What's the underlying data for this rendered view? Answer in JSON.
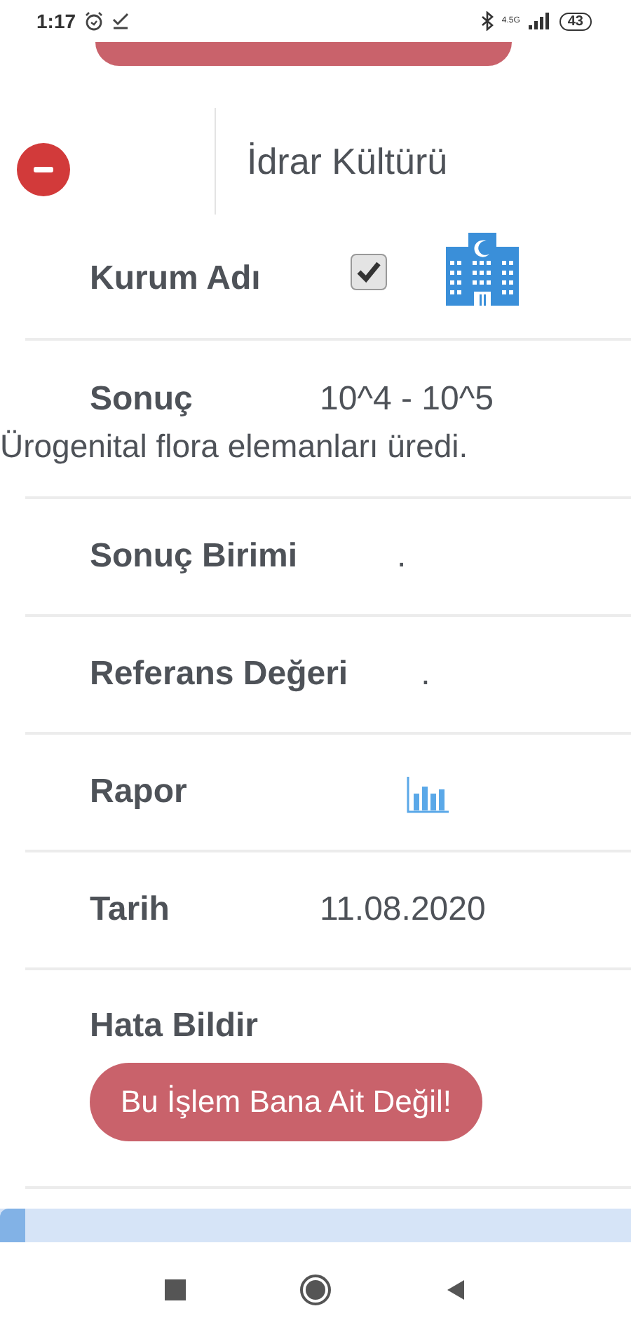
{
  "status_bar": {
    "time": "1:17",
    "network": "4.5G",
    "battery": "43"
  },
  "header": {
    "title": "İdrar Kültürü"
  },
  "rows": [
    {
      "kind": "check",
      "label": "Kurum Adı",
      "checked": true
    },
    {
      "kind": "text",
      "label": "Sonuç",
      "value": "10^4 - 10^5",
      "note": "Ürogenital flora elemanları üredi."
    },
    {
      "kind": "text",
      "label": "Sonuç Birimi",
      "value": "."
    },
    {
      "kind": "text",
      "label": "Referans Değeri",
      "value": "."
    },
    {
      "kind": "chart",
      "label": "Rapor"
    },
    {
      "kind": "text",
      "label": "Tarih",
      "value": "11.08.2020"
    },
    {
      "kind": "button",
      "label": "Hata Bildir",
      "button": "Bu İşlem Bana Ait Değil!"
    }
  ],
  "progress": {
    "level": 0.04
  }
}
